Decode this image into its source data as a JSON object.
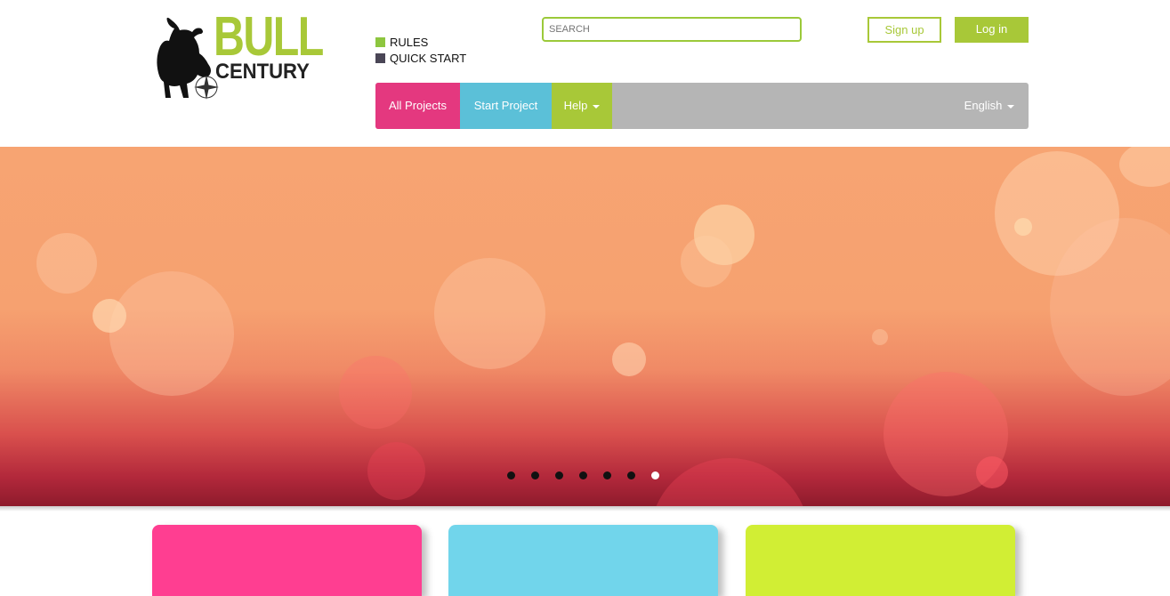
{
  "brand": {
    "line1": "BULL",
    "line2": "CENTURY"
  },
  "quick_links": [
    {
      "label": "RULES",
      "color": "#8dc63f"
    },
    {
      "label": "QUICK START",
      "color": "#4a4656"
    }
  ],
  "search": {
    "placeholder": "SEARCH",
    "value": ""
  },
  "auth": {
    "signup_label": "Sign up",
    "login_label": "Log in"
  },
  "nav": {
    "items": [
      {
        "label": "All Projects",
        "color": "#e4387f"
      },
      {
        "label": "Start Project",
        "color": "#5bc0d8"
      },
      {
        "label": "Help",
        "color": "#a8c838"
      }
    ],
    "language": "English"
  },
  "carousel": {
    "slide_count": 7,
    "active_index": 6
  },
  "cards": [
    {
      "color": "#ff3e91"
    },
    {
      "color": "#71d5eb"
    },
    {
      "color": "#d1ee34"
    }
  ]
}
